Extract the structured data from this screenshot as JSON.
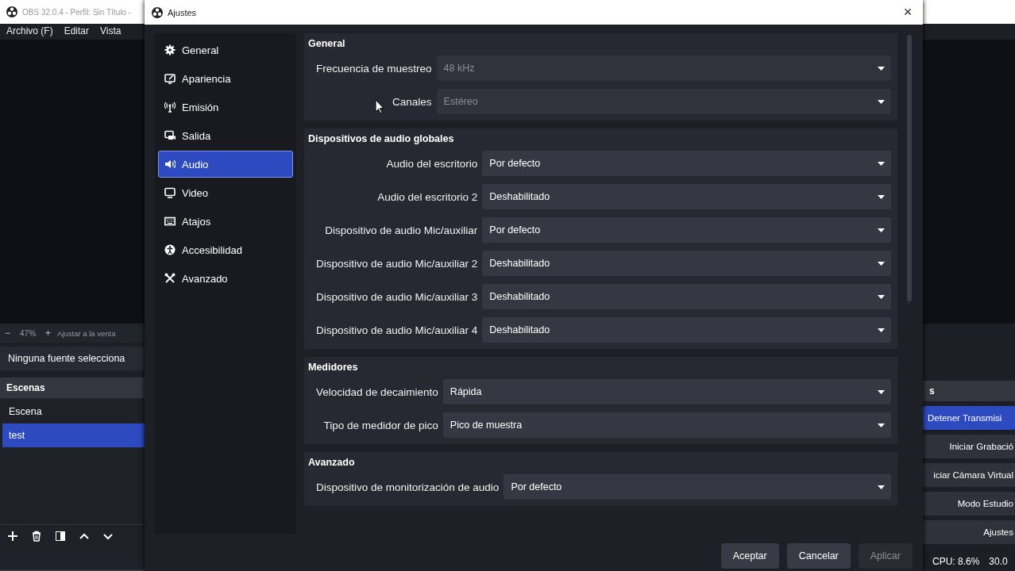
{
  "main_window": {
    "title": "OBS 32.0.4 - Perfil: Sin Título -",
    "menu": [
      "Archivo (F)",
      "Editar",
      "Vista"
    ],
    "zoom_bar": {
      "zoom_out": "−",
      "zoom": "47%",
      "zoom_in": "+",
      "fit": "Ajustar a la venta"
    },
    "source_bar": "Ninguna fuente selecciona",
    "scenes": {
      "title": "Escenas",
      "items": [
        {
          "label": "Escena",
          "selected": false
        },
        {
          "label": "test",
          "selected": true
        }
      ]
    },
    "controls": {
      "title": "s",
      "buttons": [
        {
          "label": "Detener Transmisi",
          "active": true
        },
        {
          "label": "Iniciar Grabació",
          "active": false
        },
        {
          "label": "iciar Cámara Virtual",
          "active": false
        },
        {
          "label": "Modo Estudio",
          "active": false
        },
        {
          "label": "Ajustes",
          "active": false
        }
      ]
    },
    "status_bar": [
      "CPU: 8.6%",
      "30.0"
    ]
  },
  "dialog": {
    "title": "Ajustes",
    "close": "×",
    "sidebar": [
      {
        "label": "General",
        "selected": false
      },
      {
        "label": "Apariencia",
        "selected": false
      },
      {
        "label": "Emisión",
        "selected": false
      },
      {
        "label": "Salida",
        "selected": false
      },
      {
        "label": "Audio",
        "selected": true
      },
      {
        "label": "Video",
        "selected": false
      },
      {
        "label": "Atajos",
        "selected": false
      },
      {
        "label": "Accesibilidad",
        "selected": false
      },
      {
        "label": "Avanzado",
        "selected": false
      }
    ],
    "sections": [
      {
        "title": "General",
        "rows": [
          {
            "label": "Frecuencia de muestreo",
            "value": "48 kHz",
            "disabled": true
          },
          {
            "label": "Canales",
            "value": "Estéreo",
            "disabled": true
          }
        ]
      },
      {
        "title": "Dispositivos de audio globales",
        "rows": [
          {
            "label": "Audio del escritorio",
            "value": "Por defecto",
            "disabled": false
          },
          {
            "label": "Audio del escritorio 2",
            "value": "Deshabilitado",
            "disabled": false
          },
          {
            "label": "Dispositivo de audio Mic/auxiliar",
            "value": "Por defecto",
            "disabled": false
          },
          {
            "label": "Dispositivo de audio Mic/auxiliar 2",
            "value": "Deshabilitado",
            "disabled": false
          },
          {
            "label": "Dispositivo de audio Mic/auxiliar 3",
            "value": "Deshabilitado",
            "disabled": false
          },
          {
            "label": "Dispositivo de audio Mic/auxiliar 4",
            "value": "Deshabilitado",
            "disabled": false
          }
        ]
      },
      {
        "title": "Medidores",
        "rows": [
          {
            "label": "Velocidad de decaimiento",
            "value": "Rápida",
            "disabled": false
          },
          {
            "label": "Tipo de medidor de pico",
            "value": "Pico de muestra",
            "disabled": false
          }
        ]
      },
      {
        "title": "Avanzado",
        "rows": [
          {
            "label": "Dispositivo de monitorización de audio",
            "value": "Por defecto",
            "disabled": false
          }
        ]
      }
    ],
    "buttons": [
      {
        "label": "Aceptar",
        "disabled": false
      },
      {
        "label": "Cancelar",
        "disabled": false
      },
      {
        "label": "Aplicar",
        "disabled": true
      }
    ]
  }
}
